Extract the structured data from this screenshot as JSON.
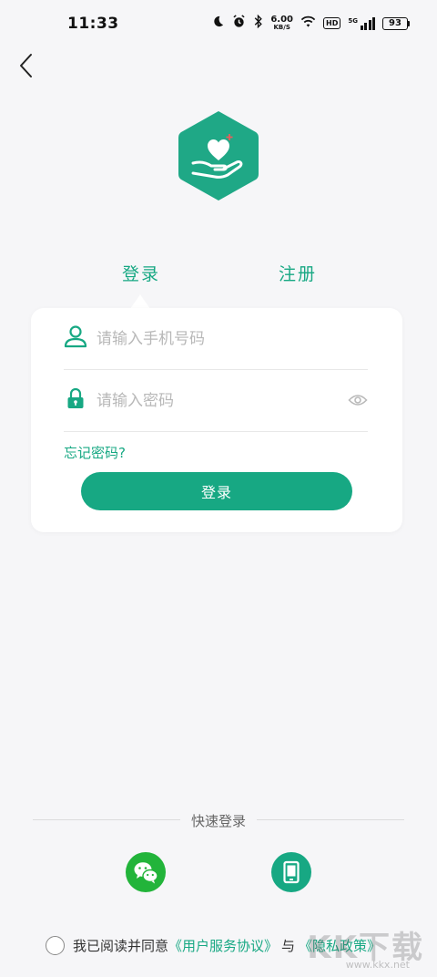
{
  "status_bar": {
    "time": "11:33",
    "net_speed": "6.00",
    "net_unit": "KB/S",
    "hd_label": "HD",
    "network": "5G",
    "battery": "93",
    "icons": [
      "moon-icon",
      "alarm-icon",
      "bluetooth-icon",
      "wifi-icon",
      "signal-icon",
      "battery-icon"
    ]
  },
  "header": {
    "back_icon": "chevron-left-icon"
  },
  "logo": {
    "icon": "heart-hand-icon",
    "color": "#1fa886"
  },
  "tabs": [
    {
      "label": "登录",
      "active": true
    },
    {
      "label": "注册",
      "active": false
    }
  ],
  "form": {
    "phone": {
      "placeholder": "请输入手机号码",
      "value": "",
      "icon": "user-icon"
    },
    "password": {
      "placeholder": "请输入密码",
      "value": "",
      "icon": "lock-icon",
      "toggle_icon": "eye-icon"
    },
    "forgot_label": "忘记密码?",
    "submit_label": "登录"
  },
  "quick_login": {
    "title": "快速登录",
    "options": [
      {
        "name": "wechat",
        "icon": "wechat-icon",
        "color": "#22b43a"
      },
      {
        "name": "phone",
        "icon": "phone-icon",
        "color": "#17a883"
      }
    ]
  },
  "agreement": {
    "prefix": "我已阅读并同意",
    "terms_link": "《用户服务协议》",
    "conjunction": "与",
    "privacy_link": "《隐私政策》",
    "checked": false
  },
  "watermark": {
    "text": "KK下载",
    "url": "www.kkx.net"
  },
  "colors": {
    "accent": "#17a883",
    "background": "#f6f6f8",
    "wechat": "#22b43a"
  }
}
